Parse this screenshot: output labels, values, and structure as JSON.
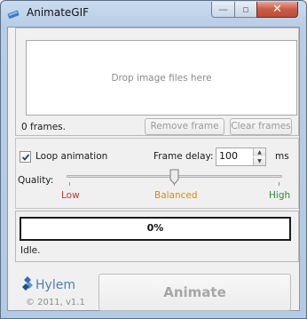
{
  "window": {
    "title": "AnimateGIF",
    "controls": {
      "minimize": "—",
      "maximize": "▫",
      "close": "✕"
    }
  },
  "frames": {
    "drop_placeholder": "Drop image files here",
    "count_label": "0 frames.",
    "remove_label": "Remove frame",
    "clear_label": "Clear frames"
  },
  "settings": {
    "loop_label": "Loop animation",
    "loop_checked": true,
    "frame_delay_label": "Frame delay:",
    "frame_delay_value": "100",
    "frame_delay_unit": "ms",
    "quality_label": "Quality:",
    "quality_value": 0.5,
    "quality_low": "Low",
    "quality_mid": "Balanced",
    "quality_high": "High",
    "colors": {
      "low": "#c0392b",
      "mid": "#e08a00",
      "high": "#2e8b2e"
    }
  },
  "progress": {
    "value": 0,
    "text": "0%",
    "status": "Idle."
  },
  "footer": {
    "logo_text": "Hylem",
    "copyright": "© 2011, v1.1",
    "animate_label": "Animate"
  }
}
